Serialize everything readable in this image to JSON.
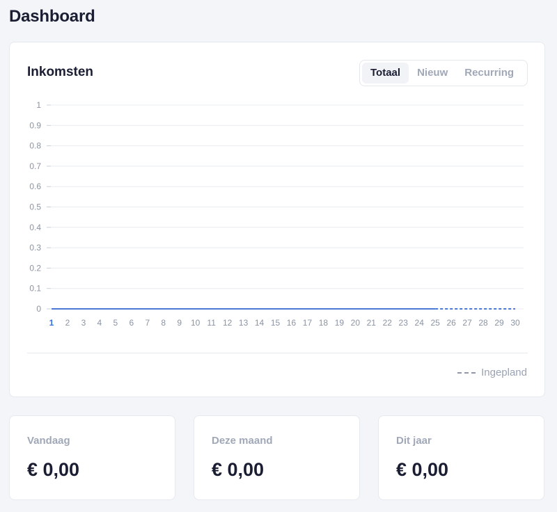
{
  "page": {
    "title": "Dashboard"
  },
  "income_card": {
    "title": "Inkomsten",
    "tabs": [
      {
        "label": "Totaal",
        "active": true
      },
      {
        "label": "Nieuw",
        "active": false
      },
      {
        "label": "Recurring",
        "active": false
      }
    ],
    "legend": {
      "planned_label": "Ingepland"
    }
  },
  "chart_data": {
    "type": "line",
    "x": [
      1,
      2,
      3,
      4,
      5,
      6,
      7,
      8,
      9,
      10,
      11,
      12,
      13,
      14,
      15,
      16,
      17,
      18,
      19,
      20,
      21,
      22,
      23,
      24,
      25,
      26,
      27,
      28,
      29,
      30
    ],
    "y_ticks": [
      "0",
      "0.1",
      "0.2",
      "0.3",
      "0.4",
      "0.5",
      "0.6",
      "0.7",
      "0.8",
      "0.9",
      "1"
    ],
    "ylim": [
      0,
      1
    ],
    "grid": true,
    "series": [
      {
        "values": [
          0,
          0,
          0,
          0,
          0,
          0,
          0,
          0,
          0,
          0,
          0,
          0,
          0,
          0,
          0,
          0,
          0,
          0,
          0,
          0,
          0,
          0,
          0,
          0,
          0
        ],
        "x_from": 1,
        "x_to": 25,
        "style": "solid",
        "color": "#4a78d4"
      },
      {
        "name": "Ingepland",
        "values": [
          0,
          0,
          0,
          0,
          0,
          0
        ],
        "x_from": 25,
        "x_to": 30,
        "style": "dashed",
        "color": "#4a78d4"
      }
    ],
    "highlight_x": 1,
    "highlight_color": "#3a6fd8"
  },
  "stats": [
    {
      "label": "Vandaag",
      "value": "€ 0,00"
    },
    {
      "label": "Deze maand",
      "value": "€ 0,00"
    },
    {
      "label": "Dit jaar",
      "value": "€ 0,00"
    }
  ]
}
